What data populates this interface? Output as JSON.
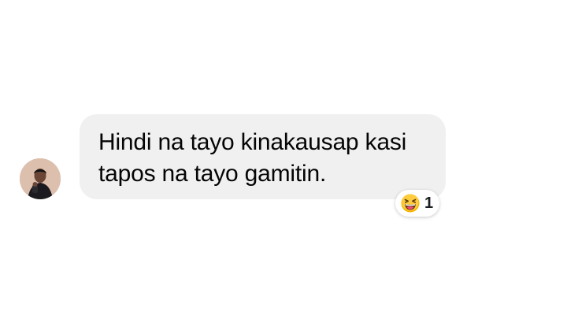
{
  "message": {
    "text_line1": "Hindi na tayo kinakausap kasi",
    "text_line2": "tapos na tayo gamitin."
  },
  "reaction": {
    "icon": "grinning-squinting-face-icon",
    "count": "1"
  },
  "colors": {
    "bubble": "#f0f0f0",
    "text": "#050505",
    "emoji": "#f7b500"
  }
}
